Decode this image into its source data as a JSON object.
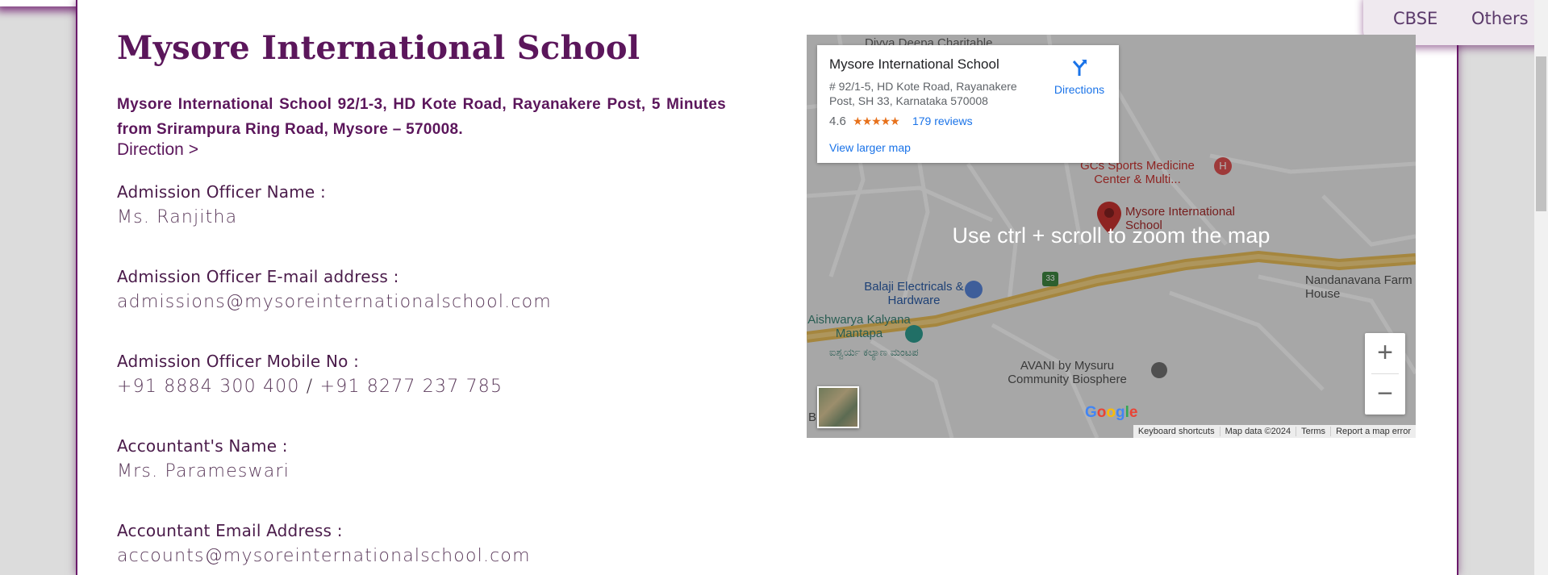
{
  "nav": {
    "items": [
      "CBSE",
      "Others"
    ]
  },
  "school": {
    "title": "Mysore International School",
    "address": "Mysore International School 92/1-3, HD Kote Road, Rayanakere Post, 5 Minutes from Srirampura Ring Road, Mysore – 570008.",
    "direction_link": "Direction >"
  },
  "contacts": [
    {
      "label": "Admission Officer Name :",
      "value": "Ms. Ranjitha"
    },
    {
      "label": "Admission Officer E-mail address :",
      "value": "admissions@mysoreinternationalschool.com"
    },
    {
      "label": "Admission Officer Mobile No :",
      "value_a": "+91 8884 300 400",
      "separator": "/",
      "value_b": "+91 8277 237 785"
    },
    {
      "label": "Accountant's Name :",
      "value": "Mrs. Parameswari"
    },
    {
      "label": "Accountant Email Address :",
      "value": "accounts@mysoreinternationalschool.com"
    }
  ],
  "map": {
    "overlay_text": "Use ctrl + scroll to zoom the map",
    "card": {
      "title": "Mysore International School",
      "address": "# 92/1-5, HD Kote Road, Rayanakere Post, SH 33, Karnataka 570008",
      "rating": "4.6",
      "stars": "★★★★★",
      "reviews": "179 reviews",
      "larger_map": "View larger map",
      "directions": "Directions"
    },
    "places": {
      "top_label": "Divya Deepa Charitable",
      "gcs": "GCs Sports Medicine Center & Multi...",
      "school_pin": "Mysore International School",
      "balaji": "Balaji Electricals & Hardware",
      "highway": "33",
      "nandanavana": "Nandanavana Farm House",
      "aishwarya": "Aishwarya Kalyana Mantapa",
      "aishwarya_kannada": "ಐಶ್ವರ್ಯ ಕಲ್ಯಾಣ ಮಂಟಪ",
      "avani": "AVANI by Mysuru Community Biosphere",
      "edge_b": "B"
    },
    "zoom_in": "+",
    "zoom_out": "−",
    "google": "Google",
    "attribution": [
      "Keyboard shortcuts",
      "Map data ©2024",
      "Terms",
      "Report a map error"
    ],
    "colors": {
      "road": "#e8b84a",
      "pin": "#c5221f",
      "link": "#1a73e8"
    }
  },
  "colors": {
    "brand": "#5b165b",
    "accent_shadow": "#6b1a6b"
  }
}
